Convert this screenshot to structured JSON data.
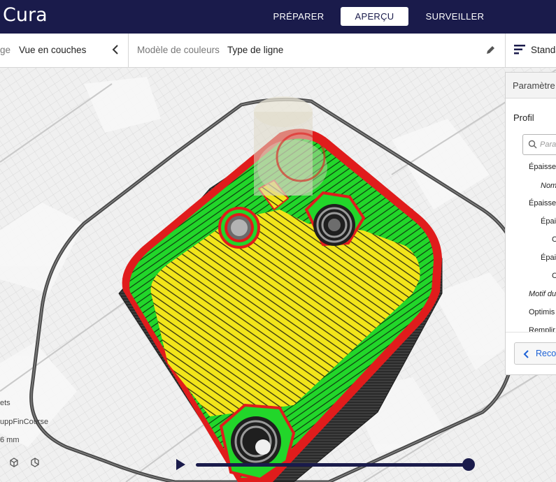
{
  "header": {
    "app_title": "Cura",
    "stages": [
      {
        "label": "PRÉPARER",
        "active": false
      },
      {
        "label": "APERÇU",
        "active": true
      },
      {
        "label": "SURVEILLER",
        "active": false
      }
    ]
  },
  "view_toolbar": {
    "view_type_label": "ge",
    "view_type_value": "Vue en couches",
    "color_scheme_label": "Modèle de couleurs",
    "color_scheme_value": "Type de ligne",
    "print_profile": "Standa"
  },
  "settings_panel": {
    "header": "Paramètre",
    "profile_label": "Profil",
    "search_placeholder": "Param",
    "items": [
      {
        "label": "Épaisseu",
        "italic": false
      },
      {
        "label": "Nom",
        "italic": true
      },
      {
        "label": "Épaisseu",
        "italic": false
      },
      {
        "label": "Épais",
        "italic": false
      },
      {
        "label": "C",
        "italic": false
      },
      {
        "label": "Épais",
        "italic": false
      },
      {
        "label": "C",
        "italic": false
      },
      {
        "label": "Motif du",
        "italic": true
      },
      {
        "label": "Optimis",
        "italic": false
      },
      {
        "label": "Remplir",
        "italic": false
      }
    ],
    "recommended_button": "Reco"
  },
  "object_info": {
    "line1": "ets",
    "line2": "uppFinCourse",
    "line3": "6 mm"
  },
  "playback": {
    "progress": 1.0
  },
  "colors": {
    "header_bg": "#1a1b4b",
    "shell": "#e01c1c",
    "inner_wall": "#22d62a",
    "skin": "#f2e51a",
    "travel_gray": "#4a4a4a",
    "accent_link": "#1e62d6"
  }
}
